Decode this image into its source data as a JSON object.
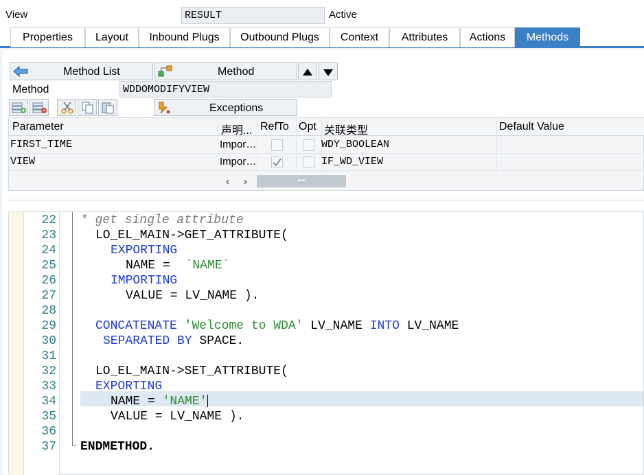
{
  "header": {
    "view_label": "View",
    "view_value": "RESULT",
    "status": "Active"
  },
  "tabs": [
    "Properties",
    "Layout",
    "Inbound Plugs",
    "Outbound Plugs",
    "Context",
    "Attributes",
    "Actions",
    "Methods"
  ],
  "active_tab": "Methods",
  "toolbar": {
    "method_list_label": "Method List",
    "method_label": "Method"
  },
  "method": {
    "label": "Method",
    "value": "WDDOMODIFYVIEW"
  },
  "exceptions_label": "Exceptions",
  "table": {
    "headers": [
      "Parameter",
      "声明...",
      "RefTo",
      "Opt",
      "关联类型",
      "Default Value"
    ],
    "rows": [
      {
        "parameter": "FIRST_TIME",
        "decl": "Impor…",
        "refto": false,
        "opt": false,
        "type": "WDY_BOOLEAN",
        "default": ""
      },
      {
        "parameter": "VIEW",
        "decl": "Impor…",
        "refto": true,
        "opt": false,
        "type": "IF_WD_VIEW",
        "default": ""
      }
    ]
  },
  "code": {
    "line_numbers": [
      "22",
      "23",
      "24",
      "25",
      "26",
      "27",
      "28",
      "29",
      "30",
      "31",
      "32",
      "33",
      "34",
      "35",
      "36",
      "37"
    ],
    "lines": {
      "l22": "* get single attribute",
      "l23a": "LO_EL_MAIN->GET_ATTRIBUTE(",
      "l24": "EXPORTING",
      "l25a": "NAME = ",
      "l25b": "`NAME`",
      "l26": "IMPORTING",
      "l27": "VALUE = LV_NAME ).",
      "l29a": "CONCATENATE",
      "l29b": "'Welcome to WDA'",
      "l29c": " LV_NAME ",
      "l29d": "INTO",
      "l29e": " LV_NAME",
      "l30a": "SEPARATED BY",
      "l30b": " SPACE.",
      "l32": "LO_EL_MAIN->SET_ATTRIBUTE(",
      "l33": "EXPORTING",
      "l34a": "NAME = ",
      "l34b": "'NAME'",
      "l35": "VALUE = LV_NAME ).",
      "l37": "ENDMETHOD."
    }
  },
  "colors": {
    "accent": "#3b7fc4",
    "keyword": "#1e3bd8",
    "string": "#2c8a2c",
    "line_number": "#2d7d8a"
  }
}
